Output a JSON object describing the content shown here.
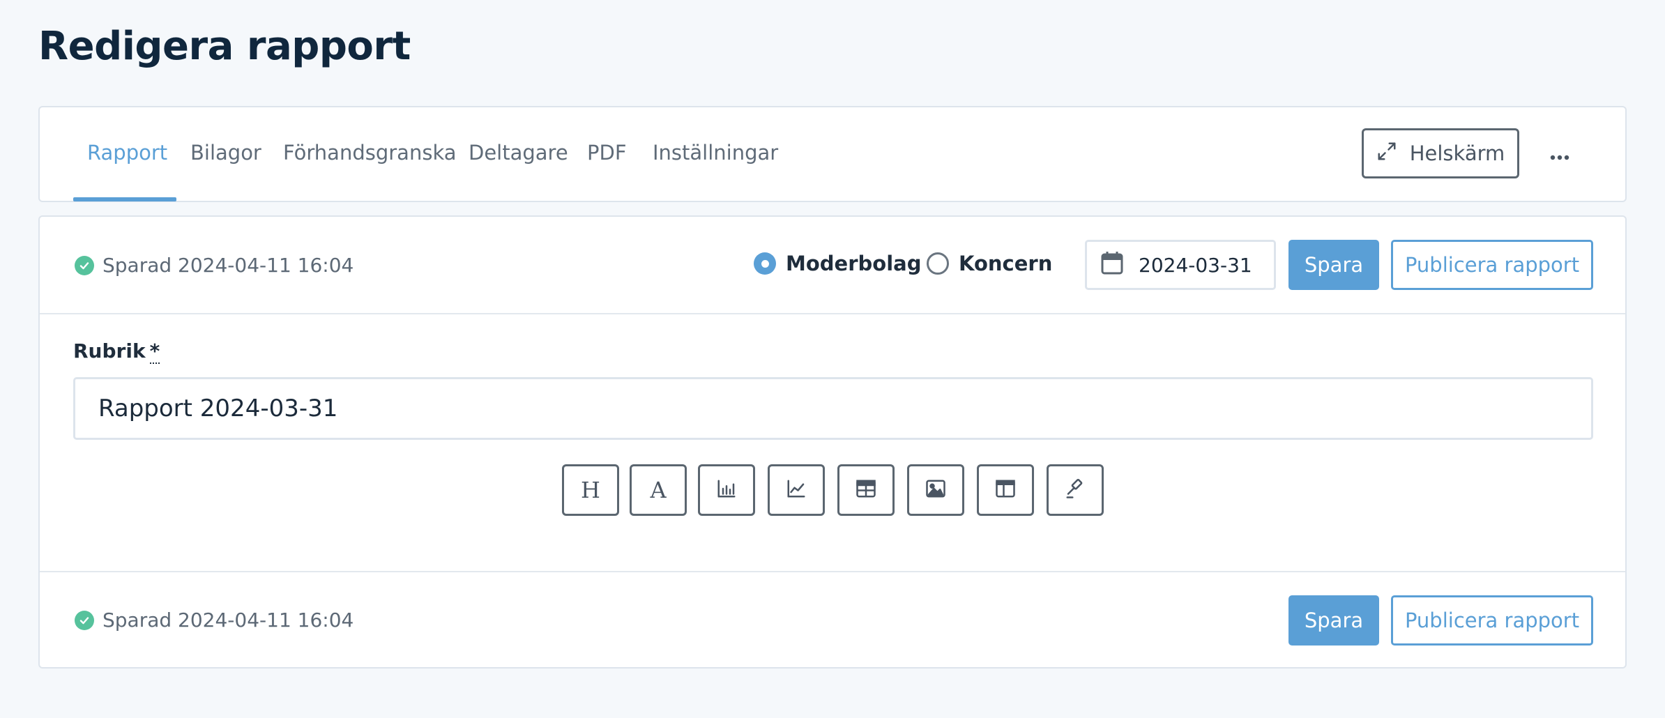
{
  "page": {
    "title": "Redigera rapport"
  },
  "tabs": [
    {
      "label": "Rapport",
      "active": true
    },
    {
      "label": "Bilagor"
    },
    {
      "label": "Förhandsgranska"
    },
    {
      "label": "Deltagare"
    },
    {
      "label": "PDF"
    },
    {
      "label": "Inställningar"
    }
  ],
  "header_actions": {
    "fullscreen_label": "Helskärm",
    "more_icon": "ellipsis-icon"
  },
  "top_bar": {
    "saved_text": "Sparad 2024-04-11 16:04",
    "radio_options": [
      {
        "label": "Moderbolag",
        "checked": true
      },
      {
        "label": "Koncern",
        "checked": false
      }
    ],
    "date_value": "2024-03-31",
    "save_label": "Spara",
    "publish_label": "Publicera rapport"
  },
  "form": {
    "title_label": "Rubrik",
    "required_marker": "*",
    "title_value": "Rapport 2024-03-31"
  },
  "toolbar": [
    {
      "name": "heading",
      "icon": "heading-icon"
    },
    {
      "name": "text",
      "icon": "text-icon"
    },
    {
      "name": "bar-chart",
      "icon": "bar-chart-icon"
    },
    {
      "name": "line-chart",
      "icon": "line-chart-icon"
    },
    {
      "name": "table",
      "icon": "table-icon"
    },
    {
      "name": "image",
      "icon": "image-icon"
    },
    {
      "name": "layout",
      "icon": "layout-icon"
    },
    {
      "name": "gavel",
      "icon": "gavel-icon"
    }
  ],
  "toolbar_glyphs": {
    "heading": "H",
    "text": "A"
  },
  "bottom_bar": {
    "saved_text": "Sparad 2024-04-11 16:04",
    "save_label": "Spara",
    "publish_label": "Publicera rapport"
  },
  "colors": {
    "accent": "#5a9fd6",
    "success": "#56c29c",
    "background": "#f5f8fb",
    "border": "#dde4ec"
  }
}
